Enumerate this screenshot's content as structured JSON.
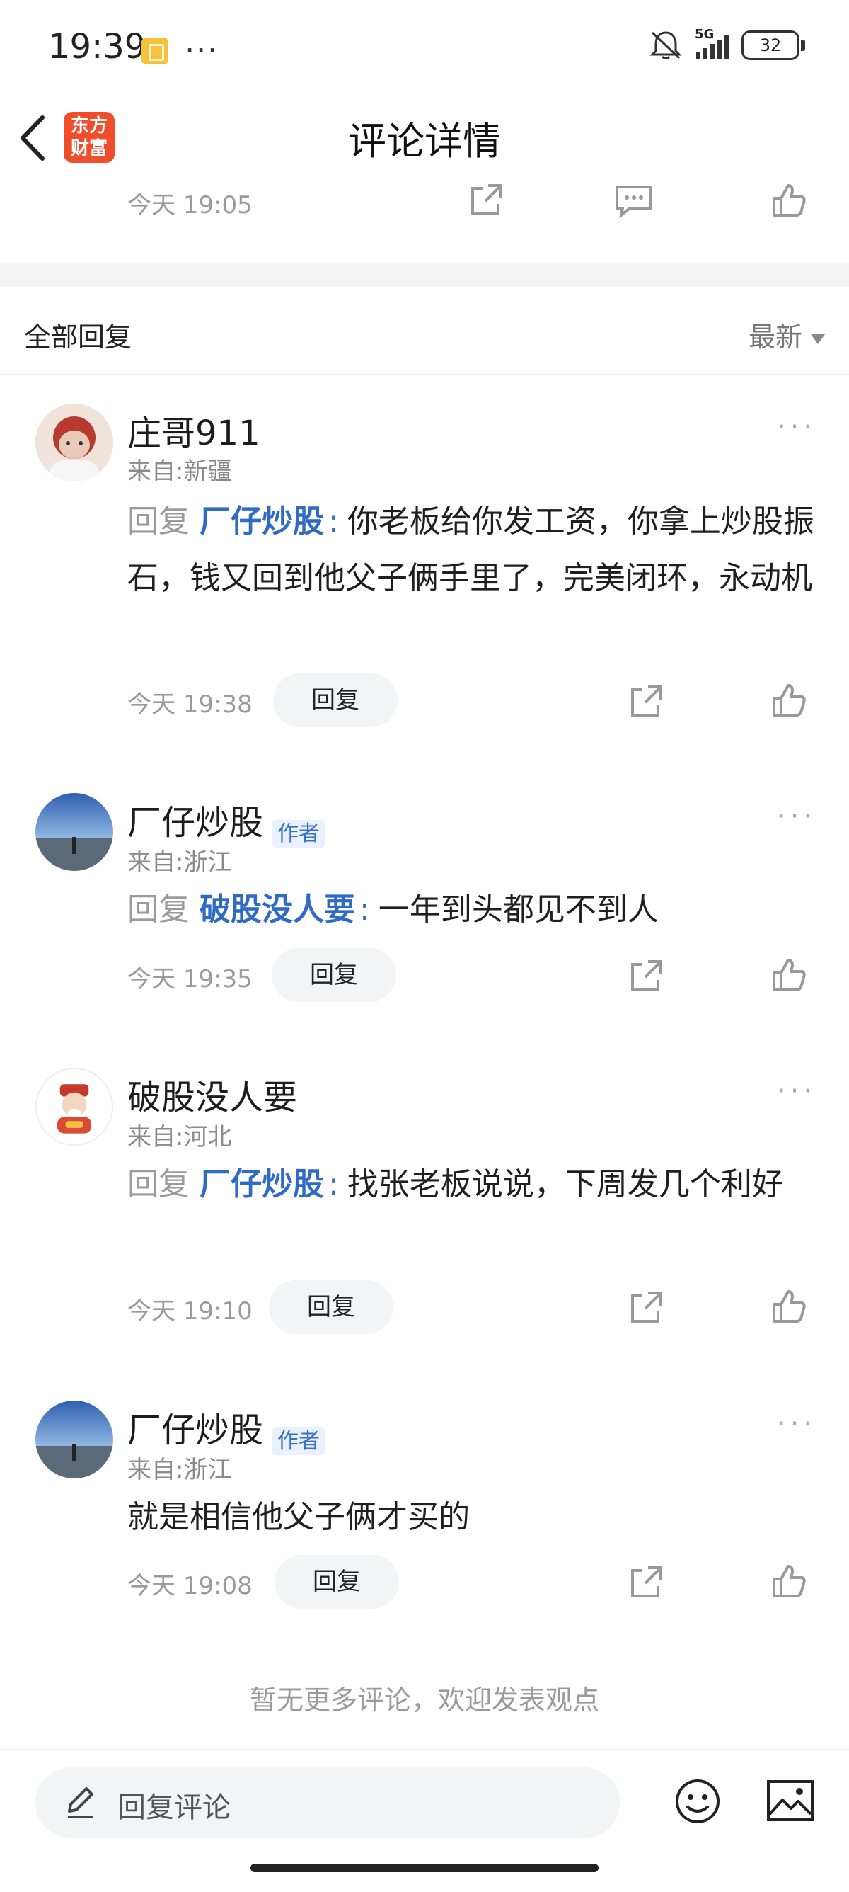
{
  "status_bar": {
    "time": "19:39",
    "signal_label": "5G",
    "battery": "32"
  },
  "header": {
    "title": "评论详情",
    "logo_line1": "东方",
    "logo_line2": "财富"
  },
  "top_item": {
    "time": "今天 19:05"
  },
  "replies_section": {
    "title": "全部回复",
    "sort_label": "最新"
  },
  "comments": [
    {
      "username": "庄哥911",
      "is_author": false,
      "location": "来自:新疆",
      "reply_word": "回复",
      "mention": "厂仔炒股",
      "text": "你老板给你发工资，你拿上炒股振石，钱又回到他父子俩手里了，完美闭环，永动机",
      "time": "今天 19:38",
      "reply_label": "回复"
    },
    {
      "username": "厂仔炒股",
      "is_author": true,
      "author_tag": "作者",
      "location": "来自:浙江",
      "reply_word": "回复",
      "mention": "破股没人要",
      "text": "一年到头都见不到人",
      "time": "今天 19:35",
      "reply_label": "回复"
    },
    {
      "username": "破股没人要",
      "is_author": false,
      "location": "来自:河北",
      "reply_word": "回复",
      "mention": "厂仔炒股",
      "text": "找张老板说说，下周发几个利好",
      "time": "今天 19:10",
      "reply_label": "回复"
    },
    {
      "username": "厂仔炒股",
      "is_author": true,
      "author_tag": "作者",
      "location": "来自:浙江",
      "text": "就是相信他父子俩才买的",
      "time": "今天 19:08",
      "reply_label": "回复"
    }
  ],
  "footer_note": "暂无更多评论，欢迎发表观点",
  "bottom_bar": {
    "input_placeholder": "回复评论"
  },
  "colors": {
    "brand": "#f04d2d",
    "mention": "#2f6bc5",
    "author_tag_bg": "#e9f1ff"
  }
}
